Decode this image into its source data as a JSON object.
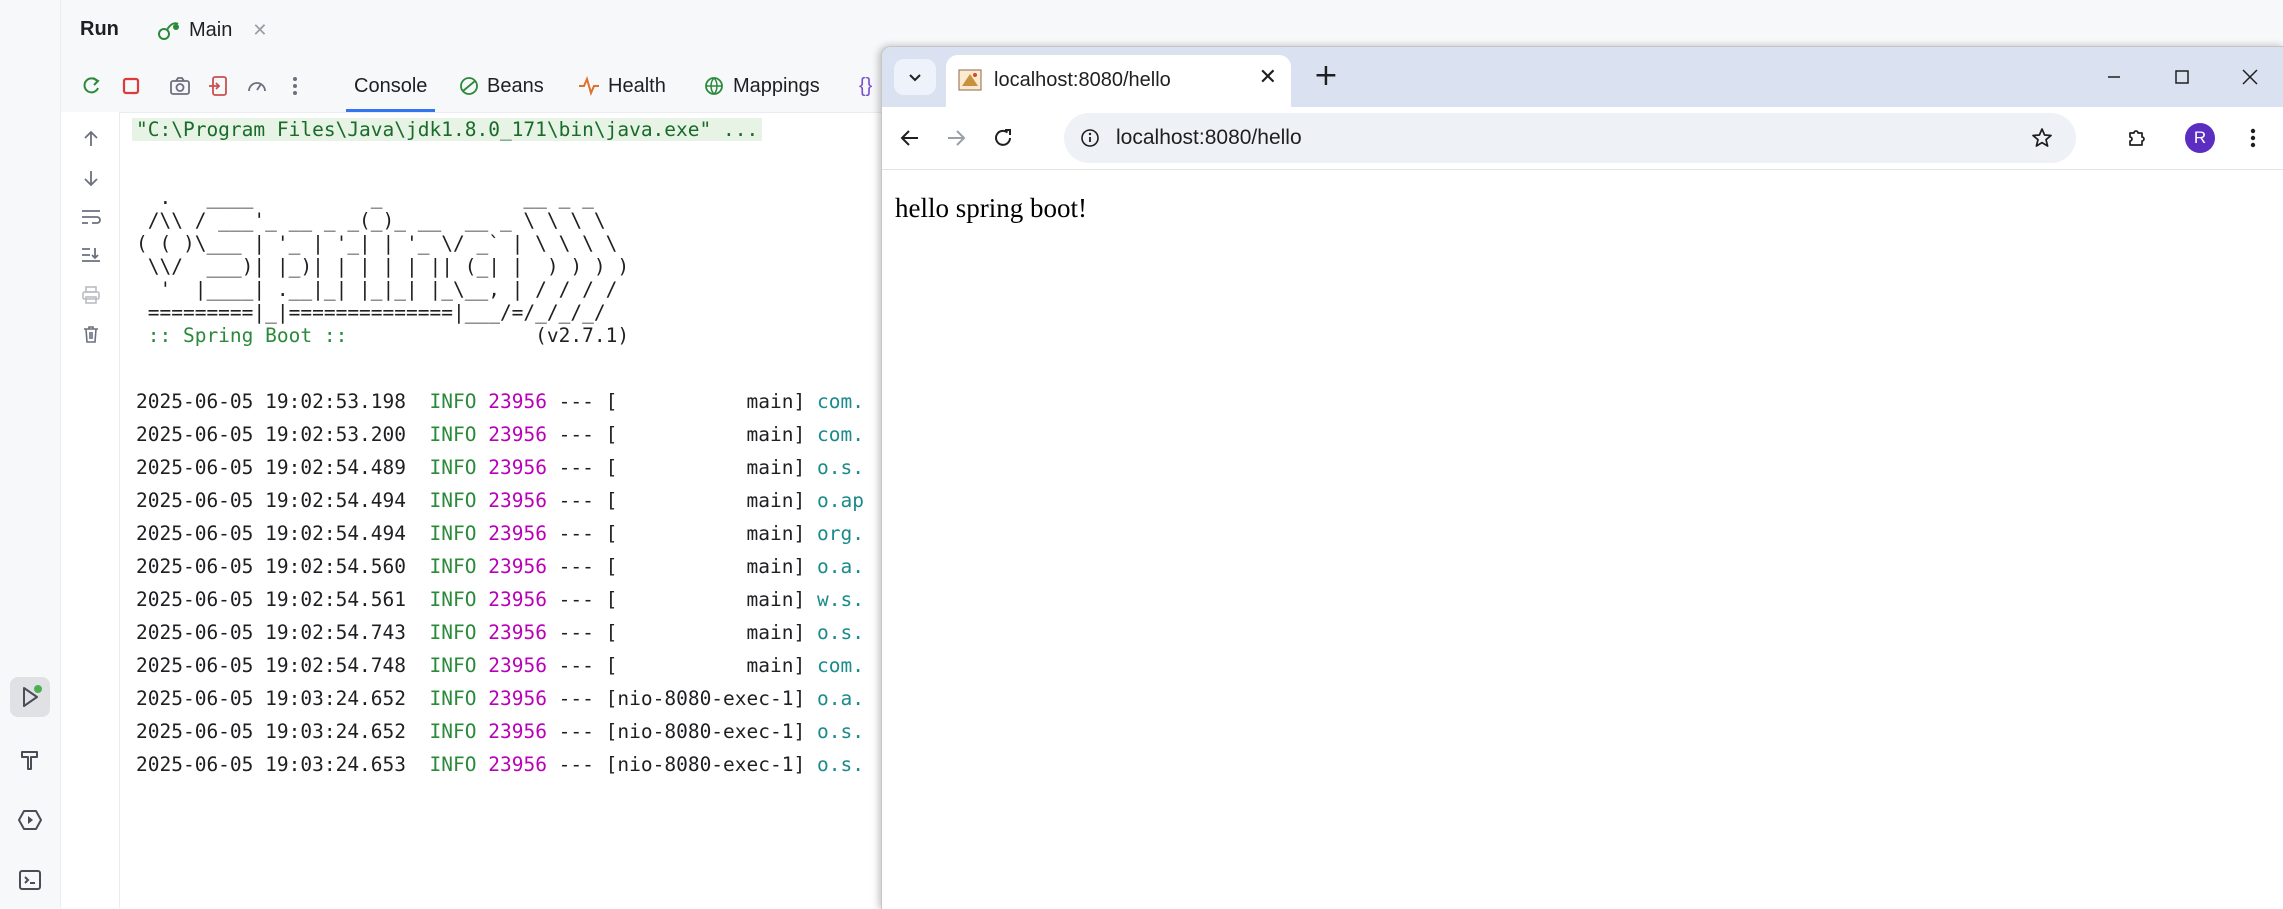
{
  "ide": {
    "run_title": "Run",
    "main_tab": "Main",
    "tabs": {
      "console": "Console",
      "beans": "Beans",
      "health": "Health",
      "mappings": "Mappings"
    },
    "console": {
      "command": "\"C:\\Program Files\\Java\\jdk1.8.0_171\\bin\\java.exe\" ...",
      "banner": [
        "  .   ____          _            __ _ _",
        " /\\\\ / ___'_ __ _ _(_)_ __  __ _ \\ \\ \\ \\",
        "( ( )\\___ | '_ | '_| | '_ \\/ _` | \\ \\ \\ \\",
        " \\\\/  ___)| |_)| | | | | || (_| |  ) ) ) )",
        "  '  |____| .__|_| |_|_| |_\\__, | / / / /",
        " =========|_|==============|___/=/_/_/_/"
      ],
      "spring_label": " :: Spring Boot ::",
      "spring_version": "                (v2.7.1)",
      "logs": [
        {
          "ts": "2025-06-05 19:02:53.198",
          "level": "INFO",
          "pid": "23956",
          "sep": " --- [",
          "thread": "           main]",
          "logger": "com."
        },
        {
          "ts": "2025-06-05 19:02:53.200",
          "level": "INFO",
          "pid": "23956",
          "sep": " --- [",
          "thread": "           main]",
          "logger": "com."
        },
        {
          "ts": "2025-06-05 19:02:54.489",
          "level": "INFO",
          "pid": "23956",
          "sep": " --- [",
          "thread": "           main]",
          "logger": "o.s."
        },
        {
          "ts": "2025-06-05 19:02:54.494",
          "level": "INFO",
          "pid": "23956",
          "sep": " --- [",
          "thread": "           main]",
          "logger": "o.ap"
        },
        {
          "ts": "2025-06-05 19:02:54.494",
          "level": "INFO",
          "pid": "23956",
          "sep": " --- [",
          "thread": "           main]",
          "logger": "org."
        },
        {
          "ts": "2025-06-05 19:02:54.560",
          "level": "INFO",
          "pid": "23956",
          "sep": " --- [",
          "thread": "           main]",
          "logger": "o.a."
        },
        {
          "ts": "2025-06-05 19:02:54.561",
          "level": "INFO",
          "pid": "23956",
          "sep": " --- [",
          "thread": "           main]",
          "logger": "w.s."
        },
        {
          "ts": "2025-06-05 19:02:54.743",
          "level": "INFO",
          "pid": "23956",
          "sep": " --- [",
          "thread": "           main]",
          "logger": "o.s."
        },
        {
          "ts": "2025-06-05 19:02:54.748",
          "level": "INFO",
          "pid": "23956",
          "sep": " --- [",
          "thread": "           main]",
          "logger": "com."
        },
        {
          "ts": "2025-06-05 19:03:24.652",
          "level": "INFO",
          "pid": "23956",
          "sep": " --- [",
          "thread": "nio-8080-exec-1]",
          "logger": "o.a."
        },
        {
          "ts": "2025-06-05 19:03:24.652",
          "level": "INFO",
          "pid": "23956",
          "sep": " --- [",
          "thread": "nio-8080-exec-1]",
          "logger": "o.s."
        },
        {
          "ts": "2025-06-05 19:03:24.653",
          "level": "INFO",
          "pid": "23956",
          "sep": " --- [",
          "thread": "nio-8080-exec-1]",
          "logger": "o.s."
        }
      ]
    }
  },
  "browser": {
    "tab_title": "localhost:8080/hello",
    "url": "localhost:8080/hello",
    "avatar_letter": "R",
    "page_text": "hello spring boot!"
  },
  "colors": {
    "accent": "#3574f0",
    "log_green": "#2a8a3a",
    "log_magenta": "#b800b8",
    "log_teal": "#1a8a8a",
    "avatar": "#5b2ec1"
  }
}
